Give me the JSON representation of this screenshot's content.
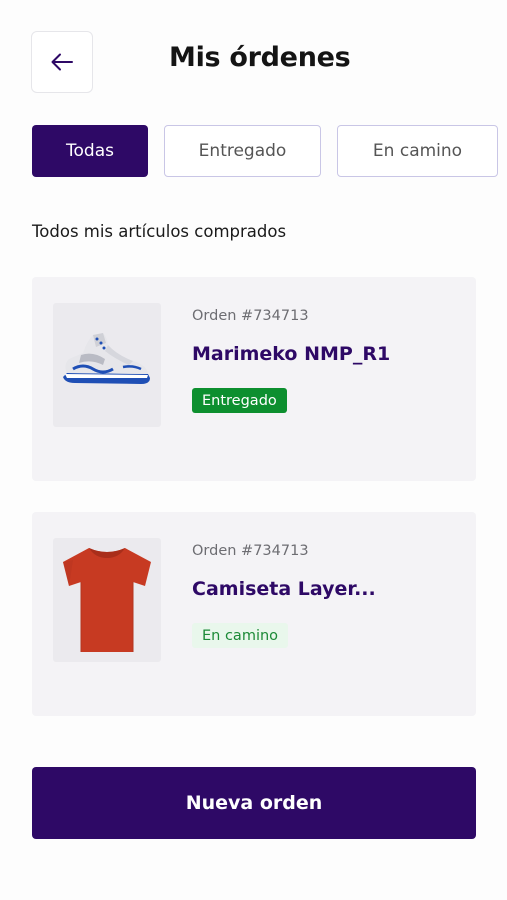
{
  "header": {
    "back_icon": "arrow-left-icon",
    "title": "Mis órdenes"
  },
  "tabs": [
    {
      "label": "Todas",
      "active": true
    },
    {
      "label": "Entregado",
      "active": false
    },
    {
      "label": "En camino",
      "active": false
    }
  ],
  "section_label": "Todos mis artículos comprados",
  "orders": [
    {
      "order_number": "Orden #734713",
      "product_name": "Marimeko NMP_R1",
      "status": "Entregado",
      "image": "sneaker-image"
    },
    {
      "order_number": "Orden #734713",
      "product_name": "Camiseta Layer...",
      "status": "En camino",
      "image": "tshirt-image"
    }
  ],
  "new_order_label": "Nueva orden",
  "colors": {
    "primary": "#2e0966",
    "delivered_badge": "#0d8f2f",
    "transit_badge_bg": "#e9f7ec",
    "transit_badge_text": "#1c8a37"
  }
}
